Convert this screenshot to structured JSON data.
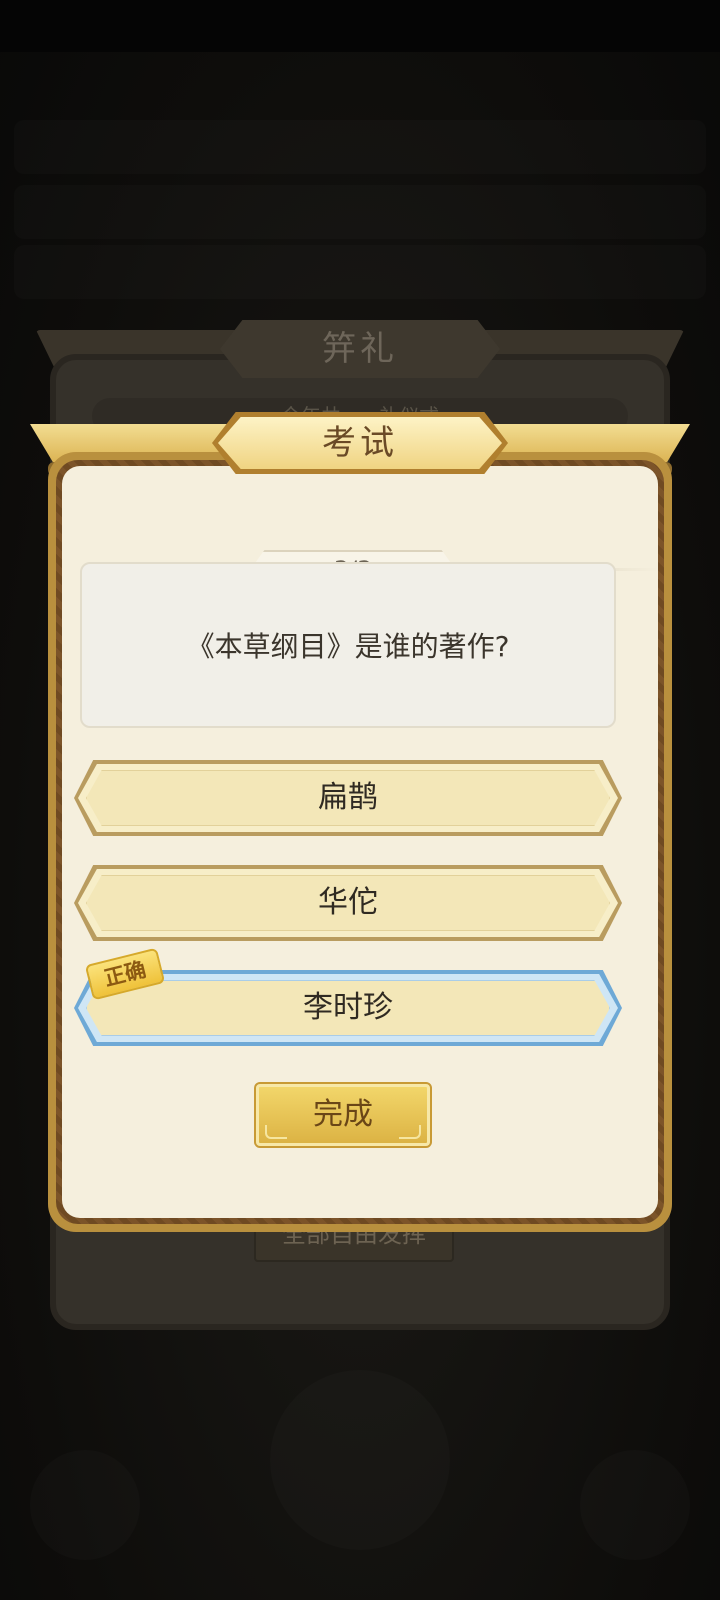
{
  "background_panel": {
    "title": "笄礼",
    "subtitle_line": "今年共......礼仪式",
    "button_label": "全部自由发挥"
  },
  "dialog": {
    "title": "考试",
    "progress": "3/3",
    "question": "《本草纲目》是谁的著作?",
    "options": [
      {
        "label": "扁鹊",
        "state": "normal"
      },
      {
        "label": "华佗",
        "state": "normal"
      },
      {
        "label": "李时珍",
        "state": "correct"
      }
    ],
    "correct_tag": "正确",
    "done_label": "完成"
  },
  "colors": {
    "paper": "#f5efdd",
    "gold": "#d9ae4a",
    "correct_border": "#6ea9d6",
    "text_dark": "#2f2a22"
  }
}
